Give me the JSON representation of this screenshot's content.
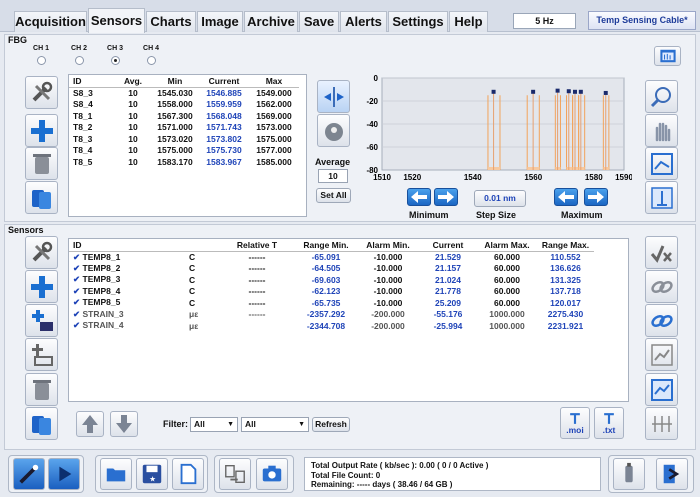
{
  "tabs": [
    "Acquisition",
    "Sensors",
    "Charts",
    "Image",
    "Archive",
    "Save",
    "Alerts",
    "Settings",
    "Help"
  ],
  "active_tab": "Sensors",
  "rate": "5 Hz",
  "cable_button": "Temp Sensing Cable*",
  "fbg": {
    "title": "FBG",
    "channels": [
      "CH 1",
      "CH 2",
      "CH 3",
      "CH 4"
    ],
    "selected_channel": "CH 3",
    "headers": [
      "ID",
      "Avg.",
      "Min",
      "Current",
      "Max"
    ],
    "rows": [
      [
        "S8_3",
        "10",
        "1545.030",
        "1546.885",
        "1549.000"
      ],
      [
        "S8_4",
        "10",
        "1558.000",
        "1559.959",
        "1562.000"
      ],
      [
        "T8_1",
        "10",
        "1567.300",
        "1568.048",
        "1569.000"
      ],
      [
        "T8_2",
        "10",
        "1571.000",
        "1571.743",
        "1573.000"
      ],
      [
        "T8_3",
        "10",
        "1573.020",
        "1573.802",
        "1575.000"
      ],
      [
        "T8_4",
        "10",
        "1575.000",
        "1575.730",
        "1577.000"
      ],
      [
        "T8_5",
        "10",
        "1583.170",
        "1583.967",
        "1585.000"
      ]
    ],
    "average_label": "Average",
    "average_value": "10",
    "set_all": "Set All",
    "minimum_label": "Minimum",
    "step_size_label": "Step Size",
    "step_size_value": "0.01 nm",
    "maximum_label": "Maximum"
  },
  "chart_data": {
    "type": "scatter",
    "x_ticks": [
      "1510",
      "1520",
      "1540",
      "1560",
      "1580",
      "1590"
    ],
    "y_ticks": [
      "0",
      "-20",
      "-40",
      "-60",
      "-80"
    ],
    "xlim": [
      1510,
      1590
    ],
    "ylim": [
      -80,
      0
    ],
    "peaks": [
      {
        "x": 1546.885,
        "y": -12
      },
      {
        "x": 1559.959,
        "y": -12
      },
      {
        "x": 1568.048,
        "y": -11
      },
      {
        "x": 1571.743,
        "y": -11.5
      },
      {
        "x": 1573.802,
        "y": -12
      },
      {
        "x": 1575.73,
        "y": -12
      },
      {
        "x": 1583.967,
        "y": -13
      }
    ],
    "ranges": [
      [
        1545.03,
        1549.0
      ],
      [
        1558.0,
        1562.0
      ],
      [
        1567.3,
        1569.0
      ],
      [
        1571.0,
        1573.0
      ],
      [
        1573.02,
        1575.0
      ],
      [
        1575.0,
        1577.0
      ],
      [
        1583.17,
        1585.0
      ]
    ]
  },
  "sensors": {
    "title": "Sensors",
    "headers": [
      "ID",
      "",
      "Relative T",
      "Range Min.",
      "Alarm Min.",
      "Current",
      "Alarm Max.",
      "Range Max."
    ],
    "rows": [
      [
        "TEMP8_1",
        "C",
        "------",
        "-65.091",
        "-10.000",
        "21.529",
        "60.000",
        "110.552"
      ],
      [
        "TEMP8_2",
        "C",
        "------",
        "-64.505",
        "-10.000",
        "21.157",
        "60.000",
        "136.626"
      ],
      [
        "TEMP8_3",
        "C",
        "------",
        "-69.603",
        "-10.000",
        "21.024",
        "60.000",
        "131.325"
      ],
      [
        "TEMP8_4",
        "C",
        "------",
        "-62.123",
        "-10.000",
        "21.778",
        "60.000",
        "137.718"
      ],
      [
        "TEMP8_5",
        "C",
        "------",
        "-65.735",
        "-10.000",
        "25.209",
        "60.000",
        "120.017"
      ],
      [
        "STRAIN_3",
        "με",
        "------",
        "-2357.292",
        "-200.000",
        "-55.176",
        "1000.000",
        "2275.430"
      ],
      [
        "STRAIN_4",
        "με",
        "",
        "-2344.708",
        "-200.000",
        "-25.994",
        "1000.000",
        "2231.921"
      ]
    ],
    "filter_label": "Filter:",
    "filter_value1": "All",
    "filter_value2": "All",
    "refresh": "Refresh",
    "moi": ".moi",
    "txt": ".txt"
  },
  "status": {
    "line1": "Total Output Rate ( kb/sec ): 0.00 ( 0 / 0 Active )",
    "line2": "Total File Count: 0",
    "line3": "Remaining: ----- days ( 38.46 / 64 GB )"
  }
}
